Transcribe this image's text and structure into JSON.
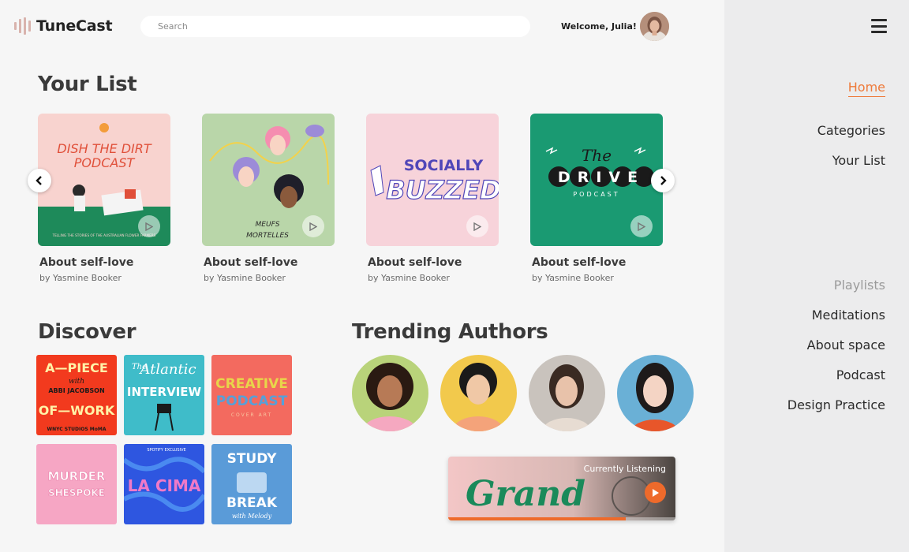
{
  "app": {
    "name": "TuneCast"
  },
  "search": {
    "placeholder": "Search"
  },
  "user": {
    "welcome": "Welcome, Julia!"
  },
  "nav": {
    "items": [
      {
        "label": "Home",
        "active": true
      },
      {
        "label": "Categories"
      },
      {
        "label": "Your List"
      }
    ],
    "playlists_heading": "Playlists",
    "playlists": [
      "Meditations",
      "About space",
      "Podcast",
      "Design Practice"
    ]
  },
  "your_list": {
    "title": "Your List",
    "cards": [
      {
        "title": "About self-love",
        "author": "by Yasmine Booker",
        "cover_text": [
          "DISH THE DIRT",
          "PODCAST"
        ],
        "cover_footer": "TELLING THE STORIES OF THE AUSTRALIAN FLOWER FARMERS"
      },
      {
        "title": "About self-love",
        "author": "by Yasmine Booker",
        "cover_text": [
          "MEUFS",
          "MORTELLES"
        ]
      },
      {
        "title": "About self-love",
        "author": "by Yasmine Booker",
        "cover_text": [
          "SOCIALLY",
          "BUZZED"
        ]
      },
      {
        "title": "About self-love",
        "author": "by Yasmine Booker",
        "cover_text": [
          "The",
          "DRIVE",
          "PODCAST"
        ]
      }
    ]
  },
  "discover": {
    "title": "Discover",
    "covers": [
      {
        "lines": [
          "A—PIECE",
          "with",
          "ABBI JACOBSON",
          "OF—WORK"
        ],
        "footer": "WNYC STUDIOS  MoMA"
      },
      {
        "lines": [
          "The",
          "Atlantic",
          "INTERVIEW"
        ]
      },
      {
        "lines": [
          "CREATIVE",
          "PODCAST"
        ],
        "footer": "COVER ART"
      },
      {
        "lines": [
          "MURDER",
          "SHESPOKE"
        ]
      },
      {
        "lines": [
          "LA CIMA"
        ],
        "footer": "SPOTIFY EXCLUSIVE"
      },
      {
        "lines": [
          "STUDY",
          "BREAK",
          "with Melody"
        ]
      }
    ]
  },
  "trending": {
    "title": "Trending Authors"
  },
  "player": {
    "label": "Currently Listening",
    "cover_text": "Grand",
    "progress": 0.78
  },
  "colors": {
    "accent": "#ee7a3a"
  }
}
